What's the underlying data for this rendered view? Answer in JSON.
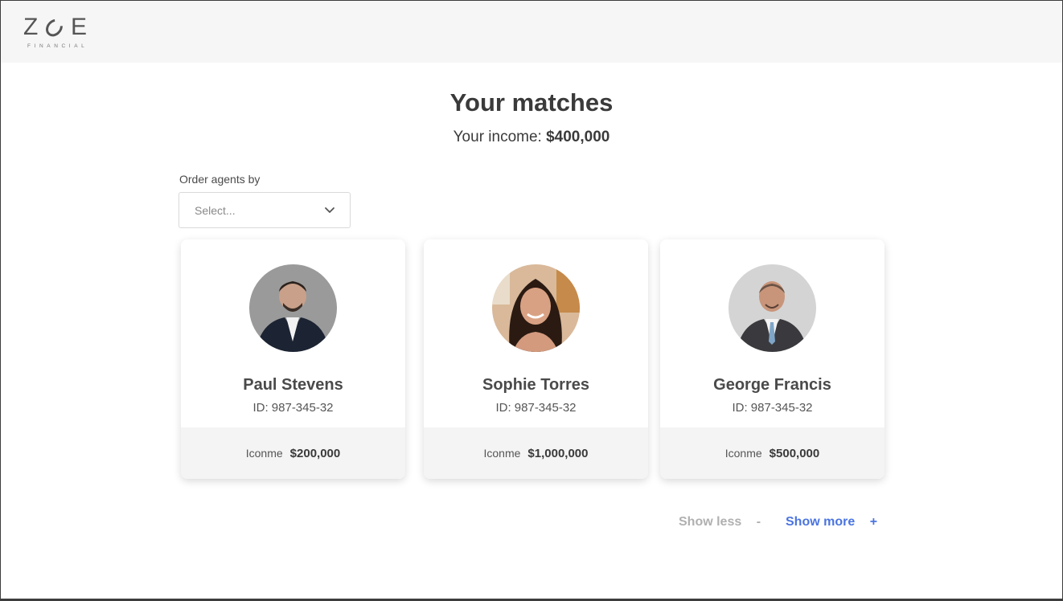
{
  "brand": {
    "name": "ZOE",
    "sub": "FINANCIAL"
  },
  "header": {
    "title": "Your matches",
    "income_label": "Your income:",
    "income_value": "$400,000"
  },
  "sort": {
    "label": "Order agents by",
    "placeholder": "Select..."
  },
  "agents": [
    {
      "name": "Paul Stevens",
      "id": "ID: 987-345-32",
      "income_label": "Iconme",
      "income": "$200,000"
    },
    {
      "name": "Sophie Torres",
      "id": "ID: 987-345-32",
      "income_label": "Iconme",
      "income": "$1,000,000"
    },
    {
      "name": "George Francis",
      "id": "ID: 987-345-32",
      "income_label": "Iconme",
      "income": "$500,000"
    }
  ],
  "pagination": {
    "show_less": "Show less",
    "show_less_symbol": "-",
    "show_more": "Show more",
    "show_more_symbol": "+"
  },
  "colors": {
    "accent": "#4a74e0",
    "muted": "#b0b0b0"
  }
}
